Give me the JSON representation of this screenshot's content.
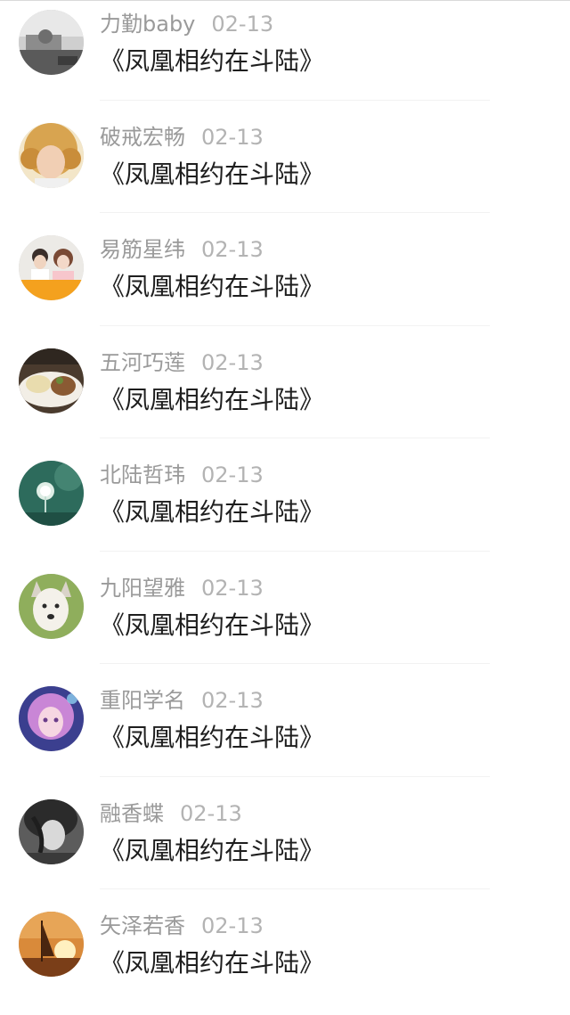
{
  "comments": [
    {
      "user": "力勤baby",
      "time": "02-13",
      "text": "《凤凰相约在斗陆》",
      "avatar_icon": "bedroom-photo-avatar"
    },
    {
      "user": "破戒宏畅",
      "time": "02-13",
      "text": "《凤凰相约在斗陆》",
      "avatar_icon": "curly-hair-child-avatar"
    },
    {
      "user": "易筋星纬",
      "time": "02-13",
      "text": "《凤凰相约在斗陆》",
      "avatar_icon": "couple-photo-avatar"
    },
    {
      "user": "五河巧莲",
      "time": "02-13",
      "text": "《凤凰相约在斗陆》",
      "avatar_icon": "food-plate-avatar"
    },
    {
      "user": "北陆哲玮",
      "time": "02-13",
      "text": "《凤凰相约在斗陆》",
      "avatar_icon": "dandelion-avatar"
    },
    {
      "user": "九阳望雅",
      "time": "02-13",
      "text": "《凤凰相约在斗陆》",
      "avatar_icon": "husky-dog-avatar"
    },
    {
      "user": "重阳学名",
      "time": "02-13",
      "text": "《凤凰相约在斗陆》",
      "avatar_icon": "anime-girl-avatar"
    },
    {
      "user": "融香蝶",
      "time": "02-13",
      "text": "《凤凰相约在斗陆》",
      "avatar_icon": "dark-anime-boy-avatar"
    },
    {
      "user": "矢泽若香",
      "time": "02-13",
      "text": "《凤凰相约在斗陆》",
      "avatar_icon": "sunset-sailboat-avatar"
    }
  ],
  "colors": {
    "username": "#9a9a9a",
    "time": "#b3b3b3",
    "message": "#1e1e1e",
    "divider": "#f2f2f2"
  }
}
